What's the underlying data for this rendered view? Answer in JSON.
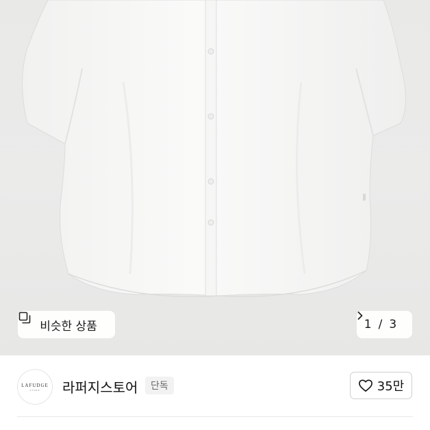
{
  "product_image": {
    "alt_label": "",
    "similar_button_label": "비슷한 상품",
    "current_page": "1",
    "total_pages": "3"
  },
  "store": {
    "logo_text": "LAFUDGE",
    "logo_subtext": "STORE",
    "name": "라퍼지스토어",
    "badge": "단독"
  },
  "like": {
    "count": "35만"
  },
  "icons": {
    "similar": "similar-items-icon",
    "next": "chevron-right-icon",
    "like": "heart-outline-icon"
  }
}
